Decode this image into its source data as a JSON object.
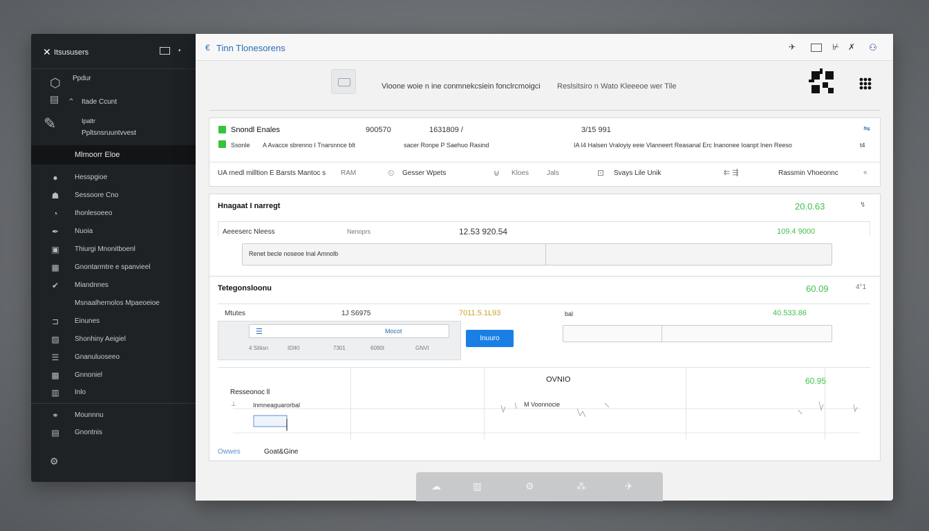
{
  "sidebar": {
    "title": "Itsususers",
    "profile": {
      "line1": "Ppdur",
      "line2": "Itade Ccunt",
      "line3": "Ipaltr",
      "line4": "Ppltsnsruuntvvest"
    },
    "active_item": "Mlmoorr Eloe",
    "items": [
      {
        "label": "Hesspgioe",
        "icon": "card-icon"
      },
      {
        "label": "Sessoore Cno",
        "icon": "person-icon"
      },
      {
        "label": "Ihonlesoeeo",
        "icon": "chart-icon"
      },
      {
        "label": "Nuoia",
        "icon": "pen-icon"
      },
      {
        "label": "Thiurgi Mnonitboenl",
        "icon": "box-icon"
      },
      {
        "label": "Gnontarmtre e spanvieel",
        "icon": "grid-icon"
      },
      {
        "label": "Miandnnes",
        "icon": "check-icon"
      },
      {
        "label": "Msnaalhernolos Mpaeoeioe",
        "icon": ""
      },
      {
        "label": "Einunes",
        "icon": "tray-icon"
      },
      {
        "label": "Shonhiny Aeigiel",
        "icon": "image-icon"
      },
      {
        "label": "Gnanuluoseeo",
        "icon": "list-icon"
      },
      {
        "label": "Gnnoniel",
        "icon": "box-icon"
      },
      {
        "label": "Inlo",
        "icon": "table-icon"
      }
    ],
    "footer_items": [
      {
        "label": "Mounnnu",
        "icon": "link-icon"
      },
      {
        "label": "Gnontnis",
        "icon": "calendar-icon"
      }
    ]
  },
  "topbar": {
    "title": "Tinn Tlonesorens"
  },
  "header": {
    "text_left": "Vioone woie n ine conmnekcsiein fonclrcmoigci",
    "text_right": "Reslsitsiro  n  Wato Kleeeoe wer Tile"
  },
  "summary": {
    "row1": {
      "label": "Snondl Enales",
      "v1": "900570",
      "v2": "1631809 /",
      "v3": "3/15 991"
    },
    "row2": {
      "label": "Ssonle",
      "c1": "A  Avacce sbrenno I Tnarsnnce blt",
      "c2": "sacer  Ronpe P Saehuo Rasind",
      "c3": "IA  I4  Halsen  Vraloyiy eeie  Vlanneert  Reasanal Erc Inanonee Ioanpt Inen Reeso",
      "c4": "t4"
    },
    "row3": {
      "c1": "UA rnedl milltion E Barsts Mantoc s",
      "c2": "RAM",
      "c3": "Gesser  Wpets",
      "c4": "Kloes",
      "c5": "Jals",
      "c6": "Svays  Lile  Unik",
      "c7": "Rassmin  Vhoeonnc"
    }
  },
  "section1": {
    "title": "Hnagaat I narregt",
    "value": "20.0.63",
    "row_label": "Aeeeserc Nleess",
    "row_label2": "Nenoprs",
    "row_num": "12.53 920.54",
    "row_green": "109.4 9000",
    "bar_text": "Renet becle noseoe lnal  Amnolb"
  },
  "section2": {
    "title": "Tetegonsloonu",
    "value": "60.09",
    "icon_text": "4°1",
    "row_label": "Mtutes",
    "row_num": "1J S6975",
    "row_gold": "7011.5.1L93",
    "row_small": "bal",
    "row_green": "40.533.86",
    "tab_label": "Mocot",
    "sub_cols": [
      "4 Sitiisn",
      "IDIKI",
      "7301",
      "6090I",
      "GNVI"
    ],
    "button": "Inuuro",
    "chart_label": "OVNIO",
    "chart_value": "60.95",
    "chart_title": "Resseonoc ll",
    "chart_sub": "Inmneaguarorbal",
    "chart_note": "M  Voonnocie",
    "footer_left": "Owwes",
    "footer_right": "Goat&Gine"
  },
  "colors": {
    "accent_green": "#3fbf4a",
    "accent_blue": "#1a7fe5",
    "sidebar_bg": "#1f2225"
  }
}
